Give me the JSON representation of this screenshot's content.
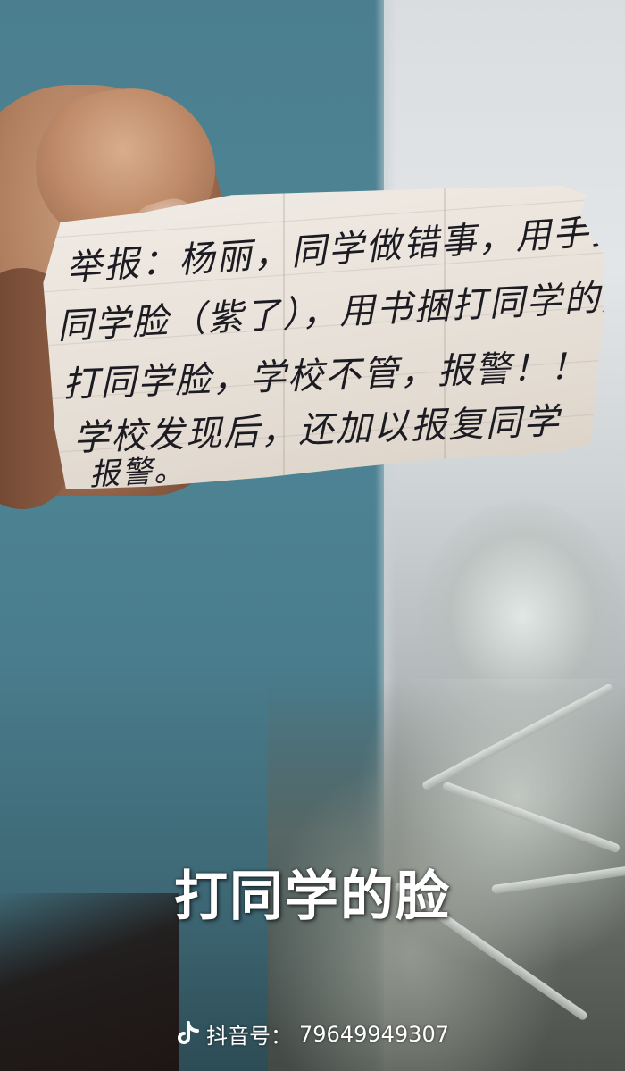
{
  "note": {
    "lines": [
      "举报：杨丽，同学做错事，用手扭",
      "同学脸（紫了），用书捆打同学的脸",
      "打同学脸，学校不管，报警！！",
      "学校发现后，还加以报复同学",
      "报警。"
    ]
  },
  "caption": {
    "text": "打同学的脸"
  },
  "watermark": {
    "icon": "tiktok-icon",
    "label": "抖音号：",
    "id": "79649949307"
  }
}
